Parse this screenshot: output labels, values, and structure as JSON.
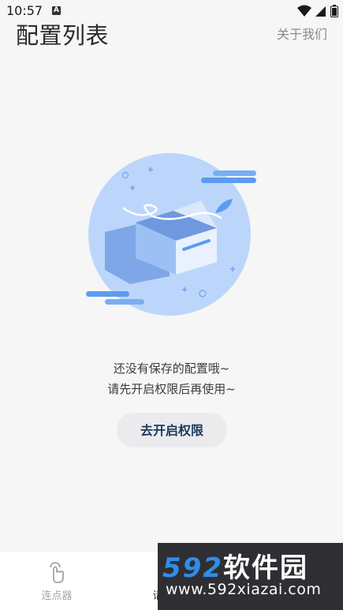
{
  "status_bar": {
    "time": "10:57",
    "notification_icon": "a-badge-icon",
    "icons": [
      "wifi-icon",
      "signal-icon",
      "battery-icon"
    ]
  },
  "header": {
    "title": "配置列表",
    "about_link": "关于我们"
  },
  "empty_state": {
    "illustration": "empty-box-illustration",
    "line1": "还没有保存的配置哦~",
    "line2": "请先开启权限后再使用~",
    "button_label": "去开启权限"
  },
  "bottom_nav": {
    "items": [
      {
        "label": "连点器",
        "icon": "tap-finger-icon"
      },
      {
        "label": "请",
        "icon": ""
      }
    ]
  },
  "watermark": {
    "brand_digits": "592",
    "brand_text": "软件园",
    "url": "www.592xiazai.com"
  },
  "colors": {
    "background": "#f6f6f7",
    "illustration_blue": "#bcd6fb",
    "accent_blue": "#5b9cf0",
    "button_bg": "#ebebed",
    "button_text": "#1a3a5c"
  }
}
